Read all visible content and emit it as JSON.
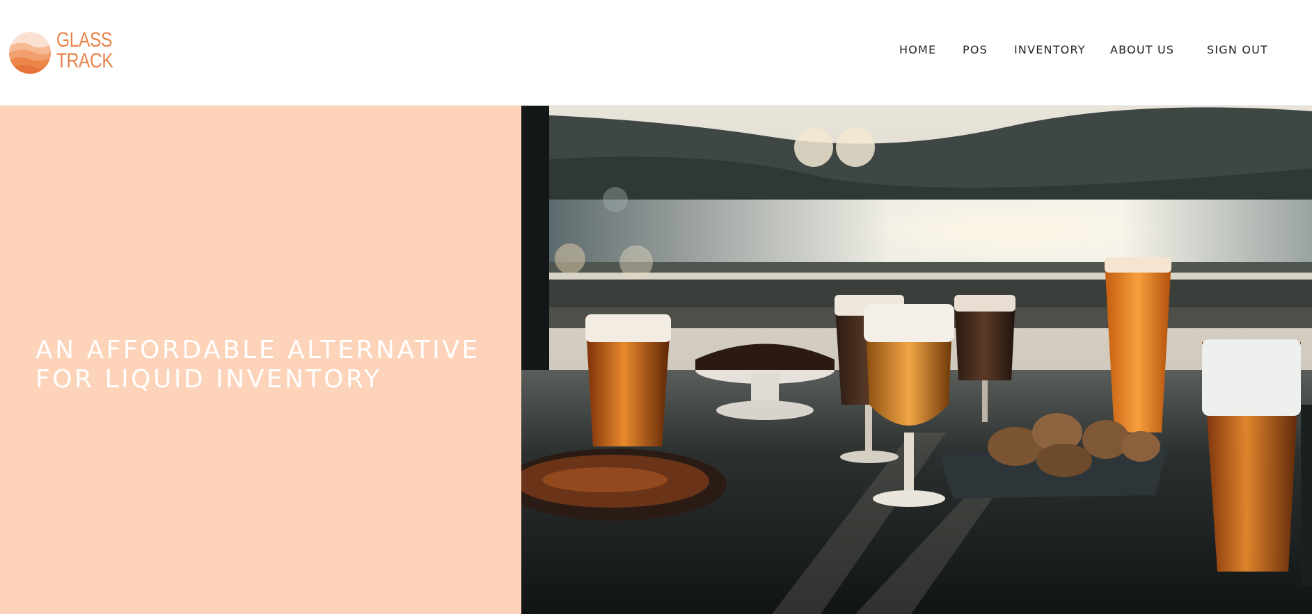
{
  "brand": {
    "line1": "GLASS",
    "line2": "TRACK",
    "color": "#e8834c",
    "icon": "sunset-hills-logo-icon"
  },
  "nav": {
    "items": [
      {
        "label": "HOME"
      },
      {
        "label": "POS"
      },
      {
        "label": "INVENTORY"
      },
      {
        "label": "ABOUT US"
      },
      {
        "label": "SIGN OUT"
      }
    ]
  },
  "hero": {
    "heading_line1": "AN AFFORDABLE ALTERNATIVE",
    "heading_line2": "FOR LIQUID INVENTORY",
    "panel_color": "#fdd3b9",
    "photo": "beer-glasses-on-table-photo"
  }
}
